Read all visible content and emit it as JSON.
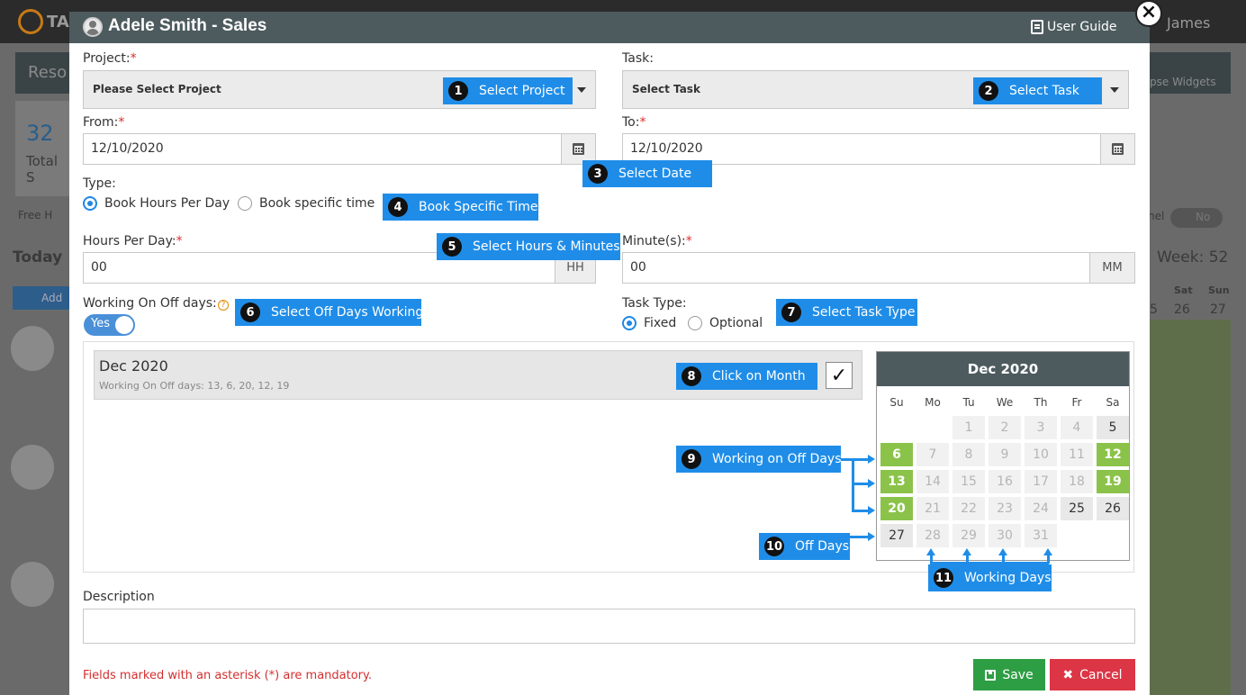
{
  "background": {
    "brand": "TA",
    "user": "James",
    "page_tab": "Reso",
    "stat_value": "32",
    "stat_label": "Total S",
    "legend_text": "Free H",
    "today": "Today",
    "add_button": "Add",
    "collapse_widgets": "pse Widgets",
    "week": "Week: 52",
    "sat": "Sat",
    "sun": "Sun",
    "d25": "5",
    "d26": "26",
    "d27": "27",
    "toggle_label": "nel",
    "toggle_value": "No"
  },
  "modal": {
    "title": "Adele Smith - Sales",
    "user_guide": "User Guide",
    "close": "×"
  },
  "project": {
    "label": "Project:",
    "required": "*",
    "placeholder": "Please Select Project"
  },
  "task": {
    "label": "Task:",
    "placeholder": "Select Task"
  },
  "from": {
    "label": "From:",
    "required": "*",
    "value": "12/10/2020"
  },
  "to": {
    "label": "To:",
    "required": "*",
    "value": "12/10/2020"
  },
  "type": {
    "label": "Type:",
    "option1": "Book Hours Per Day",
    "option2": "Book specific time"
  },
  "hours": {
    "label": "Hours Per Day:",
    "required": "*",
    "value": "00",
    "addon": "HH"
  },
  "minutes": {
    "label": "Minute(s):",
    "required": "*",
    "value": "00",
    "addon": "MM"
  },
  "offdays": {
    "label": "Working On Off days:",
    "help": "?",
    "toggle": "Yes"
  },
  "task_type": {
    "label": "Task Type:",
    "option1": "Fixed",
    "option2": "Optional"
  },
  "month": {
    "title": "Dec 2020",
    "subtitle": "Working On Off days: 13, 6, 20, 12, 19",
    "check": "✓"
  },
  "calendar": {
    "title": "Dec 2020",
    "weekdays": [
      "Su",
      "Mo",
      "Tu",
      "We",
      "Th",
      "Fr",
      "Sa"
    ],
    "days": [
      {
        "d": "",
        "s": "empty"
      },
      {
        "d": "",
        "s": "empty"
      },
      {
        "d": "1",
        "s": "work"
      },
      {
        "d": "2",
        "s": "work"
      },
      {
        "d": "3",
        "s": "work"
      },
      {
        "d": "4",
        "s": "work"
      },
      {
        "d": "5",
        "s": "off"
      },
      {
        "d": "6",
        "s": "offwork"
      },
      {
        "d": "7",
        "s": "work"
      },
      {
        "d": "8",
        "s": "work"
      },
      {
        "d": "9",
        "s": "work"
      },
      {
        "d": "10",
        "s": "work"
      },
      {
        "d": "11",
        "s": "work"
      },
      {
        "d": "12",
        "s": "offwork"
      },
      {
        "d": "13",
        "s": "offwork"
      },
      {
        "d": "14",
        "s": "work"
      },
      {
        "d": "15",
        "s": "work"
      },
      {
        "d": "16",
        "s": "work"
      },
      {
        "d": "17",
        "s": "work"
      },
      {
        "d": "18",
        "s": "work"
      },
      {
        "d": "19",
        "s": "offwork"
      },
      {
        "d": "20",
        "s": "offwork"
      },
      {
        "d": "21",
        "s": "work"
      },
      {
        "d": "22",
        "s": "work"
      },
      {
        "d": "23",
        "s": "work"
      },
      {
        "d": "24",
        "s": "work"
      },
      {
        "d": "25",
        "s": "off"
      },
      {
        "d": "26",
        "s": "off"
      },
      {
        "d": "27",
        "s": "off"
      },
      {
        "d": "28",
        "s": "work"
      },
      {
        "d": "29",
        "s": "work"
      },
      {
        "d": "30",
        "s": "work"
      },
      {
        "d": "31",
        "s": "work"
      },
      {
        "d": "",
        "s": "empty"
      },
      {
        "d": "",
        "s": "empty"
      }
    ]
  },
  "callouts": {
    "c1": {
      "n": "1",
      "text": "Select Project"
    },
    "c2": {
      "n": "2",
      "text": "Select Task"
    },
    "c3": {
      "n": "3",
      "text": "Select Date"
    },
    "c4": {
      "n": "4",
      "text": "Book Specific Time"
    },
    "c5": {
      "n": "5",
      "text": "Select Hours & Minutes"
    },
    "c6": {
      "n": "6",
      "text": "Select Off Days Working"
    },
    "c7": {
      "n": "7",
      "text": "Select Task Type"
    },
    "c8": {
      "n": "8",
      "text": "Click on Month"
    },
    "c9": {
      "n": "9",
      "text": "Working on Off Days"
    },
    "c10": {
      "n": "10",
      "text": "Off Days"
    },
    "c11": {
      "n": "11",
      "text": "Working Days"
    }
  },
  "description": {
    "label": "Description",
    "value": ""
  },
  "footer": {
    "mandatory_note": "Fields marked with an asterisk (*) are mandatory.",
    "save": "Save",
    "cancel": "Cancel"
  },
  "colors": {
    "header": "#4d5b5f",
    "callout": "#1f8de8",
    "offwork": "#8bc34a",
    "save": "#2e9e44",
    "cancel": "#dc3545"
  }
}
